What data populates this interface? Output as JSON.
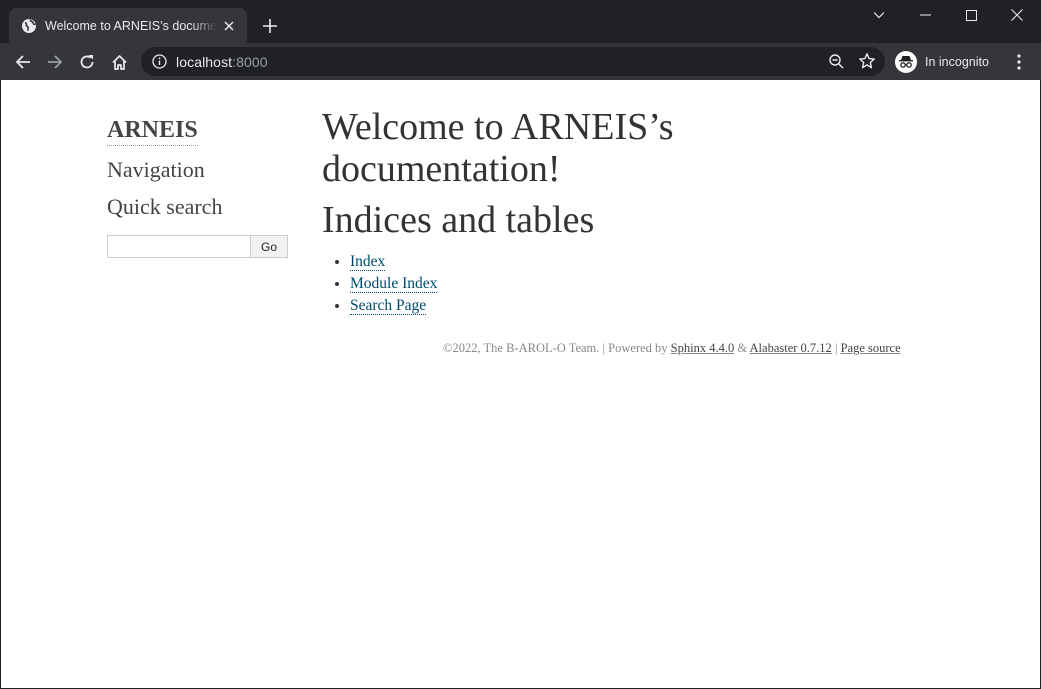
{
  "browser": {
    "tab_title": "Welcome to ARNEIS’s documentation",
    "new_tab_symbol": "+",
    "url_host": "localhost",
    "url_port": ":8000",
    "profile_label": "In incognito",
    "colors": {
      "chrome_dark": "#202124",
      "toolbar": "#35363a",
      "text": "#e8eaed"
    },
    "icons": [
      "globe-icon",
      "close-icon",
      "plus-icon",
      "chevron-down-icon",
      "minimize-icon",
      "maximize-icon",
      "window-close-icon",
      "back-arrow-icon",
      "forward-arrow-icon",
      "reload-icon",
      "home-icon",
      "info-icon",
      "zoom-icon",
      "star-icon",
      "incognito-icon",
      "kebab-menu-icon"
    ]
  },
  "sidebar": {
    "logo": "ARNEIS",
    "navigation_heading": "Navigation",
    "quick_search_heading": "Quick search",
    "search_value": "",
    "go_label": "Go"
  },
  "main": {
    "title": "Welcome to ARNEIS’s documentation!",
    "section_title": "Indices and tables",
    "links": [
      "Index",
      "Module Index",
      "Search Page"
    ],
    "link_color": "#004b6b"
  },
  "footer": {
    "copyright": "©2022, The B-AROL-O Team.",
    "sep1": " | ",
    "powered_by": "Powered by ",
    "sphinx": "Sphinx 4.4.0",
    "amp": " & ",
    "alabaster": "Alabaster 0.7.12",
    "sep2": " | ",
    "page_source": "Page source"
  }
}
